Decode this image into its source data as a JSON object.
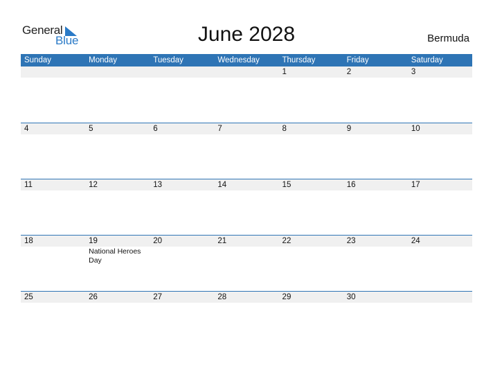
{
  "logo": {
    "general": "General",
    "blue": "Blue",
    "accent": "#2a7ac7"
  },
  "title": "June 2028",
  "country": "Bermuda",
  "colors": {
    "header_bg": "#2e74b5",
    "strip_bg": "#f0f0f0"
  },
  "weekdays": [
    "Sunday",
    "Monday",
    "Tuesday",
    "Wednesday",
    "Thursday",
    "Friday",
    "Saturday"
  ],
  "weeks": [
    {
      "days": [
        "",
        "",
        "",
        "",
        "1",
        "2",
        "3"
      ],
      "events": [
        "",
        "",
        "",
        "",
        "",
        "",
        ""
      ]
    },
    {
      "days": [
        "4",
        "5",
        "6",
        "7",
        "8",
        "9",
        "10"
      ],
      "events": [
        "",
        "",
        "",
        "",
        "",
        "",
        ""
      ]
    },
    {
      "days": [
        "11",
        "12",
        "13",
        "14",
        "15",
        "16",
        "17"
      ],
      "events": [
        "",
        "",
        "",
        "",
        "",
        "",
        ""
      ]
    },
    {
      "days": [
        "18",
        "19",
        "20",
        "21",
        "22",
        "23",
        "24"
      ],
      "events": [
        "",
        "National Heroes Day",
        "",
        "",
        "",
        "",
        ""
      ]
    },
    {
      "days": [
        "25",
        "26",
        "27",
        "28",
        "29",
        "30",
        ""
      ],
      "events": [
        "",
        "",
        "",
        "",
        "",
        "",
        ""
      ]
    }
  ]
}
